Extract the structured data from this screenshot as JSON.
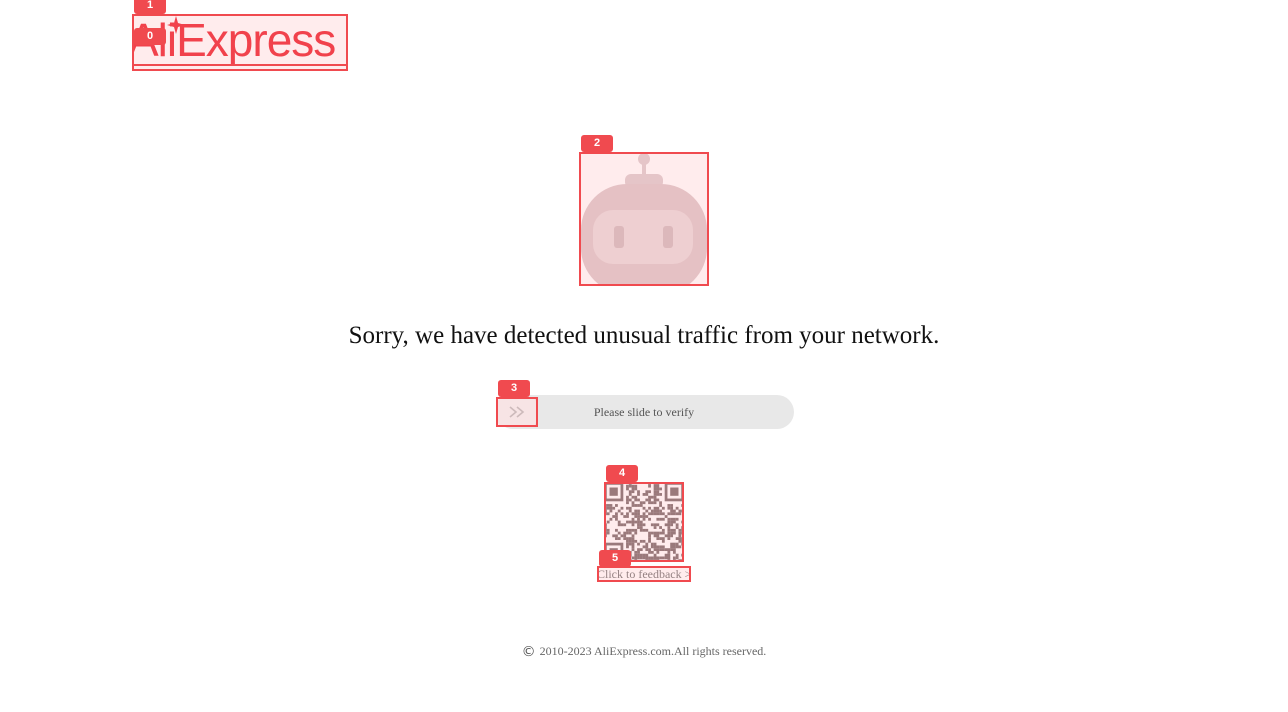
{
  "brand": {
    "logo_text": "AliExpress",
    "color": "#f0424c"
  },
  "robot_icon": "robot-icon",
  "message": {
    "headline": "Sorry, we have detected unusual traffic from your network."
  },
  "slider": {
    "label": "Please slide to verify",
    "handle_icon": "double-chevron-right-icon"
  },
  "qr_code": {
    "icon": "qr-code-icon"
  },
  "feedback": {
    "label": "Click to feedback >"
  },
  "footer": {
    "copyright_symbol": "©",
    "text": "2010-2023 AliExpress.com.All rights reserved."
  },
  "annotations": {
    "labels": [
      "0",
      "1",
      "2",
      "3",
      "4",
      "5"
    ],
    "color": "#f04a4f"
  }
}
